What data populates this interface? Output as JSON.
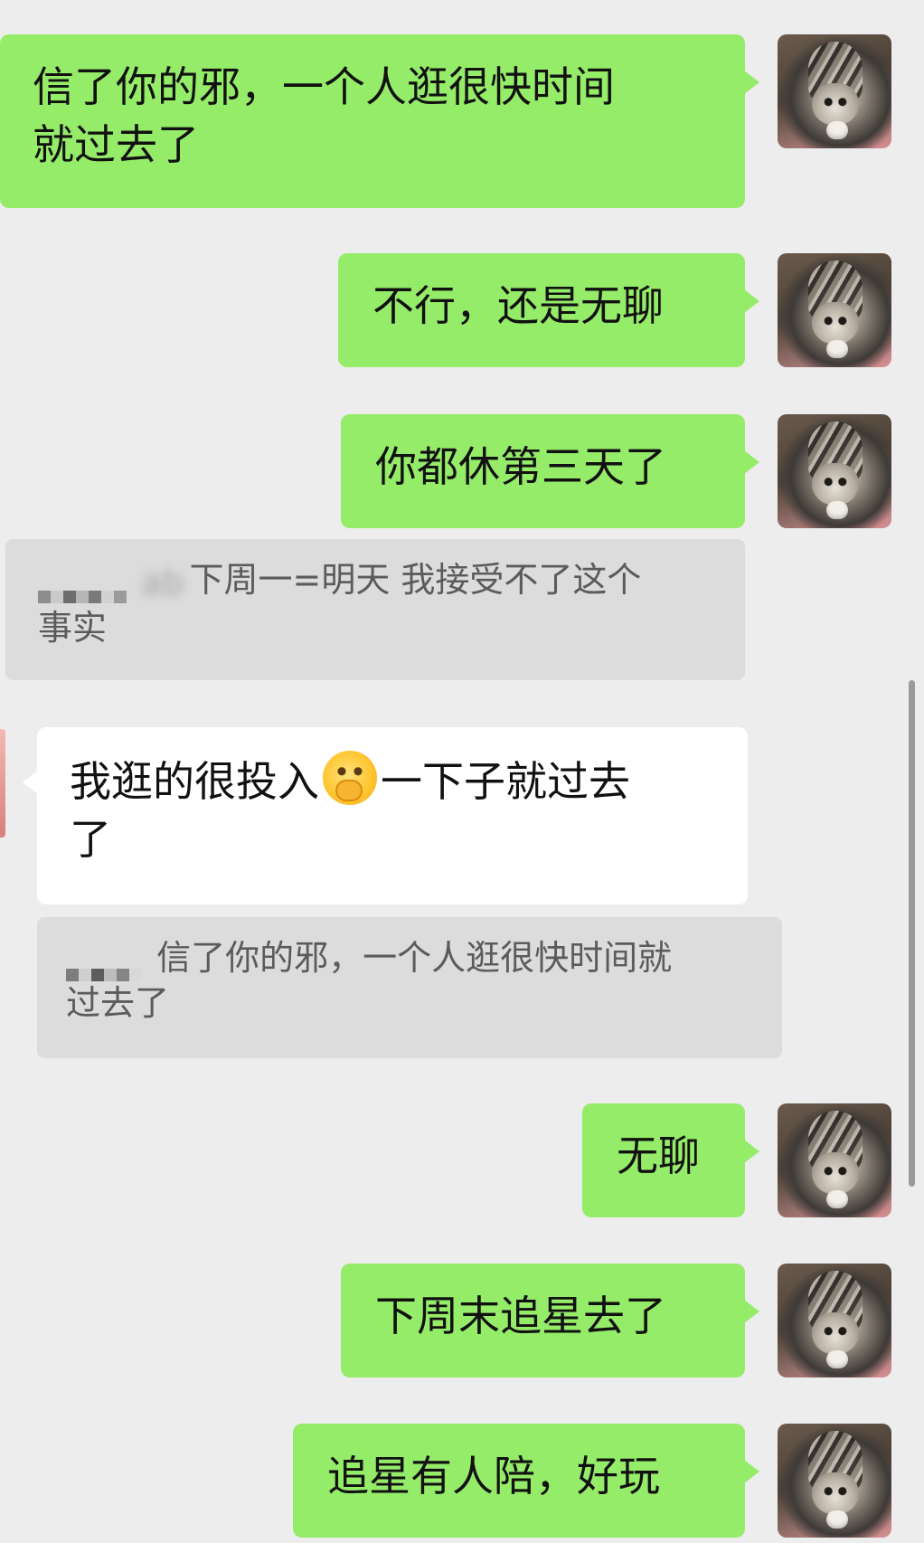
{
  "messages": [
    {
      "side": "mine",
      "lines": [
        "信了你的邪，一个人逛很快时间",
        "就过去了"
      ]
    },
    {
      "side": "mine",
      "lines": [
        "不行，还是无聊"
      ]
    },
    {
      "side": "mine",
      "lines": [
        "你都休第三天了"
      ]
    },
    {
      "type": "quote",
      "lines": [
        "下周一=明天 我接受不了这个",
        "事实"
      ]
    },
    {
      "side": "theirs",
      "lines": [
        "我逛的很投入",
        "一下子就过去",
        "了"
      ],
      "emoji": "face-with-hand-over-mouth"
    },
    {
      "type": "quote",
      "lines": [
        "信了你的邪，一个人逛很快时间就",
        "过去了"
      ]
    },
    {
      "side": "mine",
      "lines": [
        "无聊"
      ]
    },
    {
      "side": "mine",
      "lines": [
        "下周末追星去了"
      ]
    },
    {
      "side": "mine",
      "lines": [
        "追星有人陪，好玩"
      ]
    }
  ],
  "colors": {
    "background": "#ededed",
    "mine_bubble": "#95ec69",
    "theirs_bubble": "#ffffff",
    "quote_bg": "#dcdcdc"
  },
  "icons": {
    "avatar": "cat-photo-avatar",
    "emoji": "face-with-hand-over-mouth"
  }
}
